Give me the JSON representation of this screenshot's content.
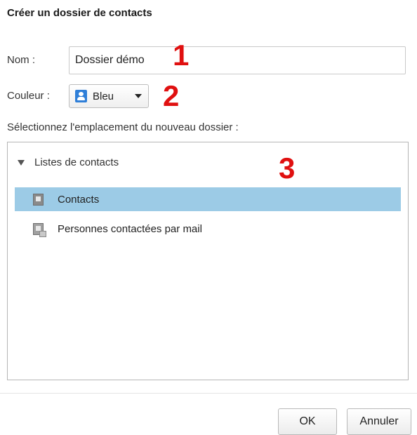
{
  "dialog": {
    "title": "Créer un dossier de contacts"
  },
  "name_field": {
    "label": "Nom :",
    "value": "Dossier démo"
  },
  "color_field": {
    "label": "Couleur :",
    "selected": "Bleu",
    "swatch_color": "#2f7fd8"
  },
  "location": {
    "label": "Sélectionnez l'emplacement du nouveau dossier :",
    "root_label": "Listes de contacts",
    "items": [
      {
        "label": "Contacts",
        "selected": true,
        "icon": "address-book-icon"
      },
      {
        "label": "Personnes contactées par mail",
        "selected": false,
        "icon": "address-book-mail-icon"
      }
    ]
  },
  "annotations": [
    "1",
    "2",
    "3"
  ],
  "buttons": {
    "ok": "OK",
    "cancel": "Annuler"
  },
  "colors": {
    "selection": "#9ccbe6",
    "annotation": "#e01010"
  }
}
